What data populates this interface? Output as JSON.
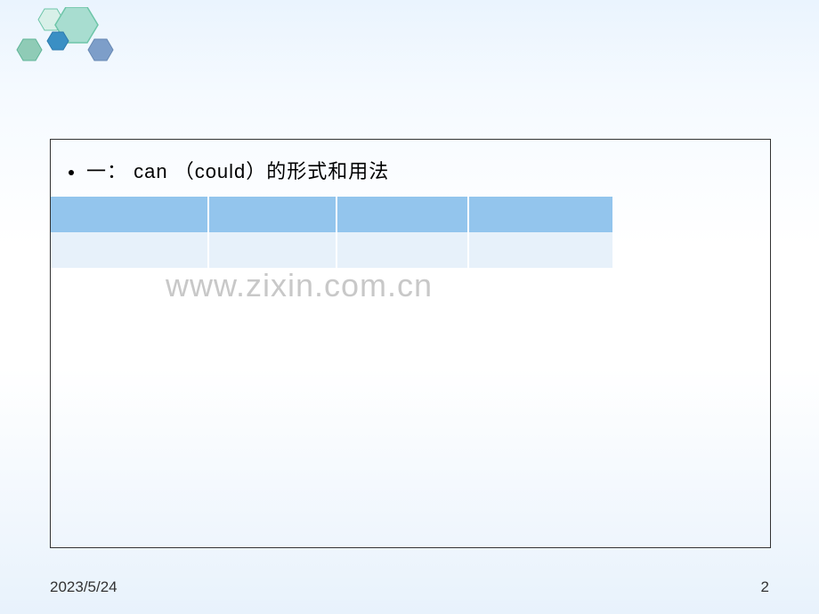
{
  "slide": {
    "title": "一： can （could）的形式和用法",
    "table": {
      "rows": 3,
      "cols": 4
    },
    "watermark": "www.zixin.com.cn",
    "footer": {
      "date": "2023/5/24",
      "page": "2"
    }
  },
  "decoration": {
    "hexagons": [
      {
        "fill": "#d8f0e8",
        "stroke": "#6dc5a8"
      },
      {
        "fill": "#e5f4fb",
        "stroke": "#78bce0"
      },
      {
        "fill": "#3a8fc4",
        "stroke": "#2c7aad"
      },
      {
        "fill": "#5fb598",
        "stroke": "#4a9d82"
      },
      {
        "fill": "#7d9ec9",
        "stroke": "#6788b3"
      }
    ]
  }
}
